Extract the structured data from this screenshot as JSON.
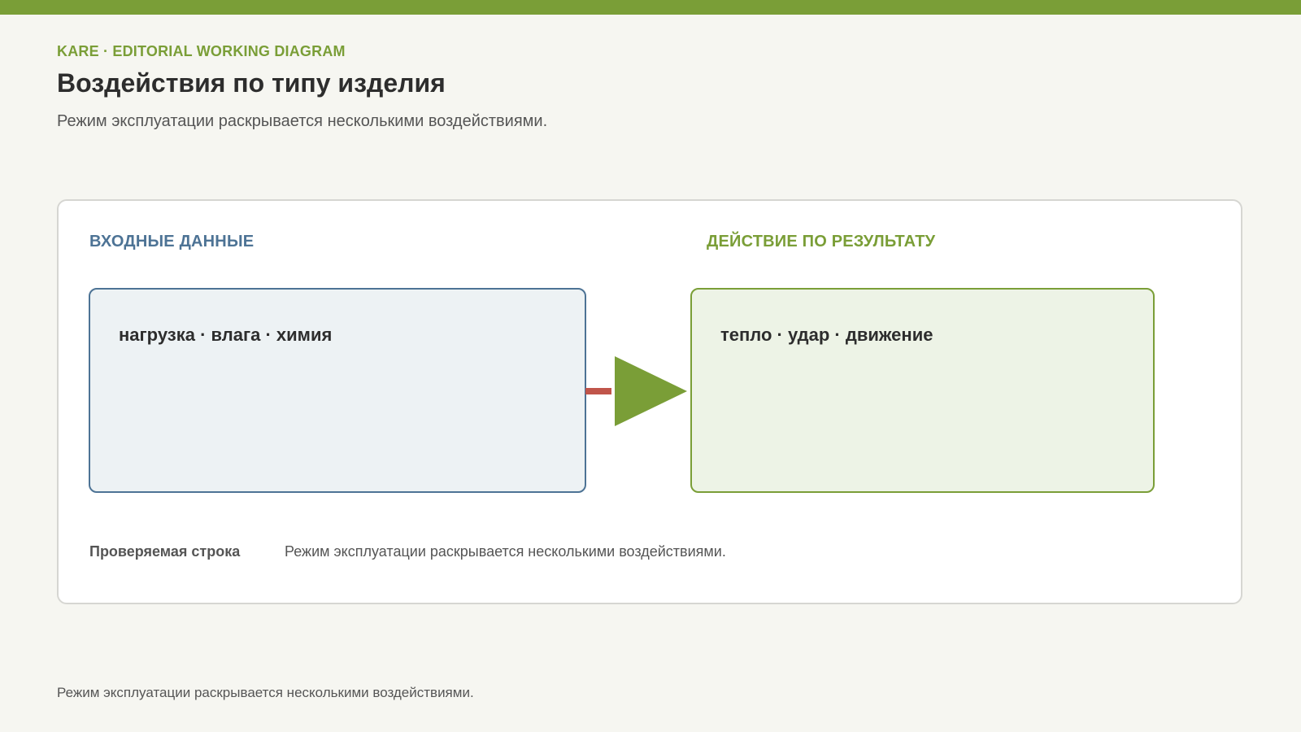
{
  "header": {
    "eyebrow": "KARE · EDITORIAL WORKING DIAGRAM",
    "title": "Воздействия по типу изделия",
    "subtitle": "Режим эксплуатации раскрывается несколькими воздействиями."
  },
  "diagram": {
    "input_label": "ВХОДНЫЕ ДАННЫЕ",
    "output_label": "ДЕЙСТВИЕ ПО РЕЗУЛЬТАТУ",
    "input_node": "нагрузка · влага · химия",
    "output_node": "тепло · удар · движение",
    "connector": {
      "from": "input_node",
      "to": "output_node",
      "icon": "arrow-right-icon"
    }
  },
  "check_row": {
    "label": "Проверяемая строка",
    "value": "Режим эксплуатации раскрывается несколькими воздействиями."
  },
  "footer": {
    "text": "Режим эксплуатации раскрывается несколькими воздействиями."
  },
  "colors": {
    "accent_green": "#7a9e37",
    "accent_blue": "#4d7395",
    "connector_red": "#c0554a",
    "input_fill": "#edf2f4",
    "output_fill": "#edf3e6",
    "background": "#f6f6f1"
  }
}
